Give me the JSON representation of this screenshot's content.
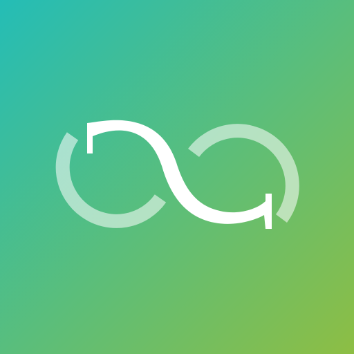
{
  "icon": {
    "name": "infinity-loop-logo",
    "background": {
      "gradient_start": "#24BDB6",
      "gradient_end": "#8DBE44"
    },
    "mark": {
      "front_color": "#FFFFFF",
      "back_color": "#FFFFFF",
      "back_opacity": 0.55
    }
  }
}
